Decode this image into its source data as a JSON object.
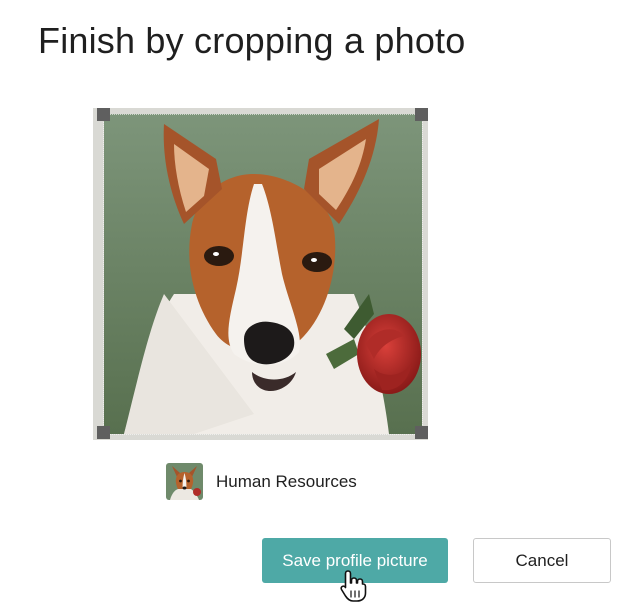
{
  "dialog": {
    "title": "Finish by cropping a photo"
  },
  "account": {
    "name": "Human Resources"
  },
  "buttons": {
    "save_label": "Save profile picture",
    "cancel_label": "Cancel"
  },
  "colors": {
    "primary_button": "#4ea9a6",
    "photo_background": "#6f8a6b"
  },
  "icons": {
    "cursor": "hand-pointer-icon"
  }
}
